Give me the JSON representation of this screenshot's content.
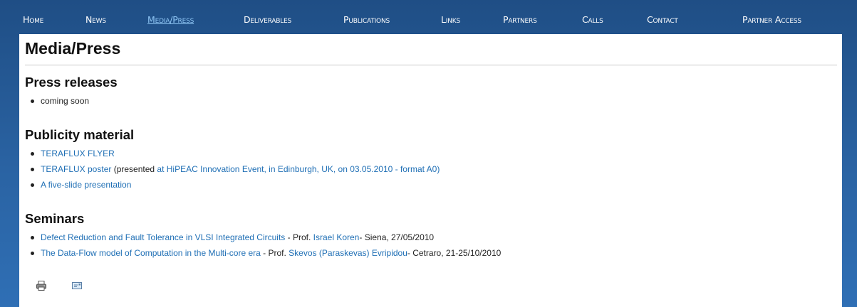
{
  "nav": {
    "items": [
      {
        "label": "Home",
        "active": false
      },
      {
        "label": "News",
        "active": false
      },
      {
        "label": "Media/Press",
        "active": true
      },
      {
        "label": "Deliverables",
        "active": false
      },
      {
        "label": "Publications",
        "active": false
      },
      {
        "label": "Links",
        "active": false
      },
      {
        "label": "Partners",
        "active": false
      },
      {
        "label": "Calls",
        "active": false
      },
      {
        "label": "Contact",
        "active": false
      },
      {
        "label": "Partner Access",
        "active": false
      }
    ]
  },
  "page": {
    "title": "Media/Press"
  },
  "sections": {
    "press_releases": {
      "heading": "Press releases",
      "items": [
        {
          "text": "coming soon"
        }
      ]
    },
    "publicity_material": {
      "heading": "Publicity material",
      "flyer": {
        "link": "TERAFLUX FLYER"
      },
      "poster": {
        "link": "TERAFLUX poster",
        "prefix": " (presented ",
        "event_link": "at HiPEAC Innovation Event, in Edinburgh, UK, on 03.05.2010 - format A0)"
      },
      "presentation": {
        "link": "A five-slide presentation"
      }
    },
    "seminars": {
      "heading": "Seminars",
      "items": [
        {
          "title_link": "Defect Reduction and Fault Tolerance in VLSI Integrated Circuits",
          "mid": " - Prof. ",
          "speaker_link": "Israel Koren",
          "suffix": "- Siena, 27/05/2010"
        },
        {
          "title_link": "The Data-Flow model of Computation in the Multi-core era",
          "mid": " - Prof. ",
          "speaker_link": "Skevos (Paraskevas) Evripidou",
          "suffix": "- Cetraro, 21-25/10/2010"
        }
      ]
    }
  },
  "tools": {
    "print_icon": "printer-icon",
    "email_icon": "email-icon"
  },
  "colors": {
    "background_top": "#1f4e85",
    "background_bottom": "#2f6fb5",
    "link": "#1f6fb5",
    "nav_active": "#8fc6f5"
  }
}
